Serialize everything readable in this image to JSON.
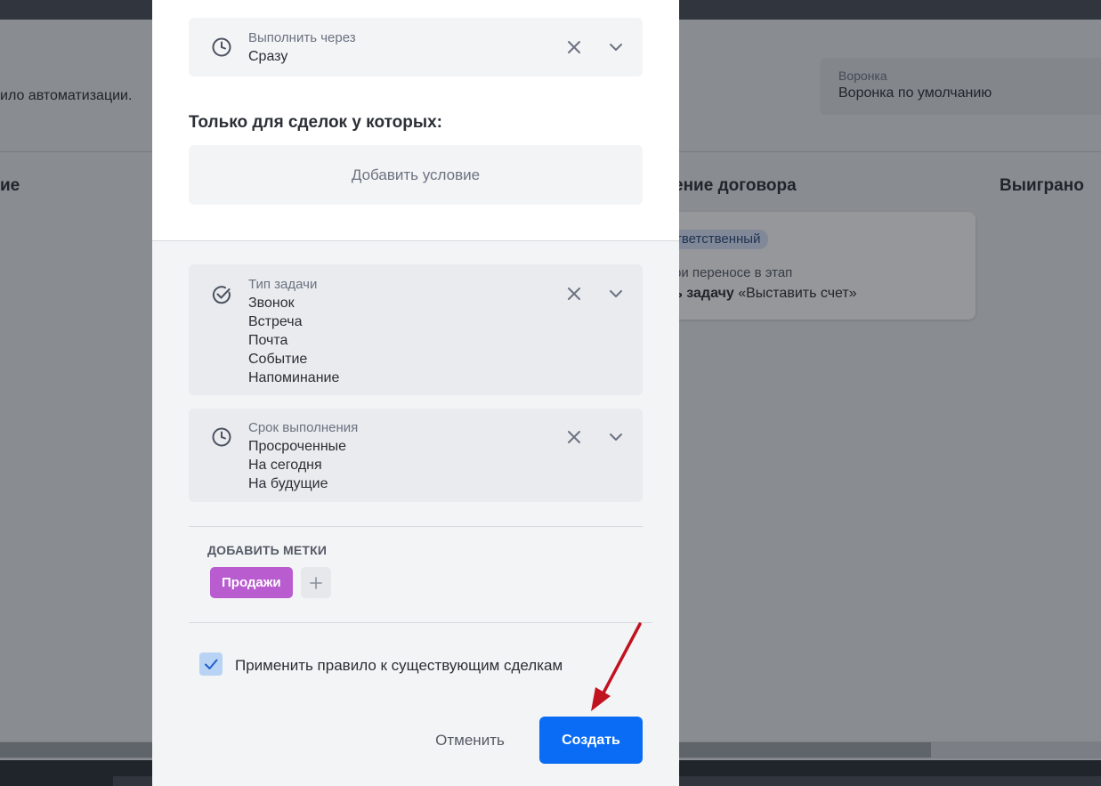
{
  "background": {
    "description_fragment": "ило автоматизации.",
    "funnel": {
      "label": "Воронка",
      "value": "Воронка по умолчанию"
    },
    "columns": [
      {
        "title": "ие"
      },
      {
        "title": "ение договора"
      },
      {
        "title": "Выиграно"
      }
    ],
    "card": {
      "badge": "тветственный",
      "subtitle": "ри переносе в этап",
      "text_bold": "ь задачу",
      "text_rest": " «Выставить счет»"
    }
  },
  "modal": {
    "execute_field": {
      "label": "Выполнить через",
      "value": "Сразу",
      "icon": "clock-icon"
    },
    "conditions_title": "Только для сделок у которых:",
    "add_condition_label": "Добавить условие",
    "task_type_field": {
      "label": "Тип задачи",
      "icon": "check-circle-icon",
      "values": [
        "Звонок",
        "Встреча",
        "Почта",
        "Событие",
        "Напоминание"
      ]
    },
    "due_field": {
      "label": "Срок выполнения",
      "icon": "clock-icon",
      "values": [
        "Просроченные",
        "На сегодня",
        "На будущие"
      ]
    },
    "tags": {
      "title": "ДОБАВИТЬ МЕТКИ",
      "items": [
        {
          "label": "Продажи",
          "color": "#b85ccf"
        }
      ],
      "add_symbol": "+"
    },
    "apply_existing": {
      "label": "Применить правило к существующим сделкам",
      "checked": true
    },
    "cancel_label": "Отменить",
    "create_label": "Создать"
  },
  "colors": {
    "primary": "#0a6cf5",
    "tag": "#b85ccf",
    "arrow": "#c1121f",
    "checkbox": "#b9d3f5"
  }
}
